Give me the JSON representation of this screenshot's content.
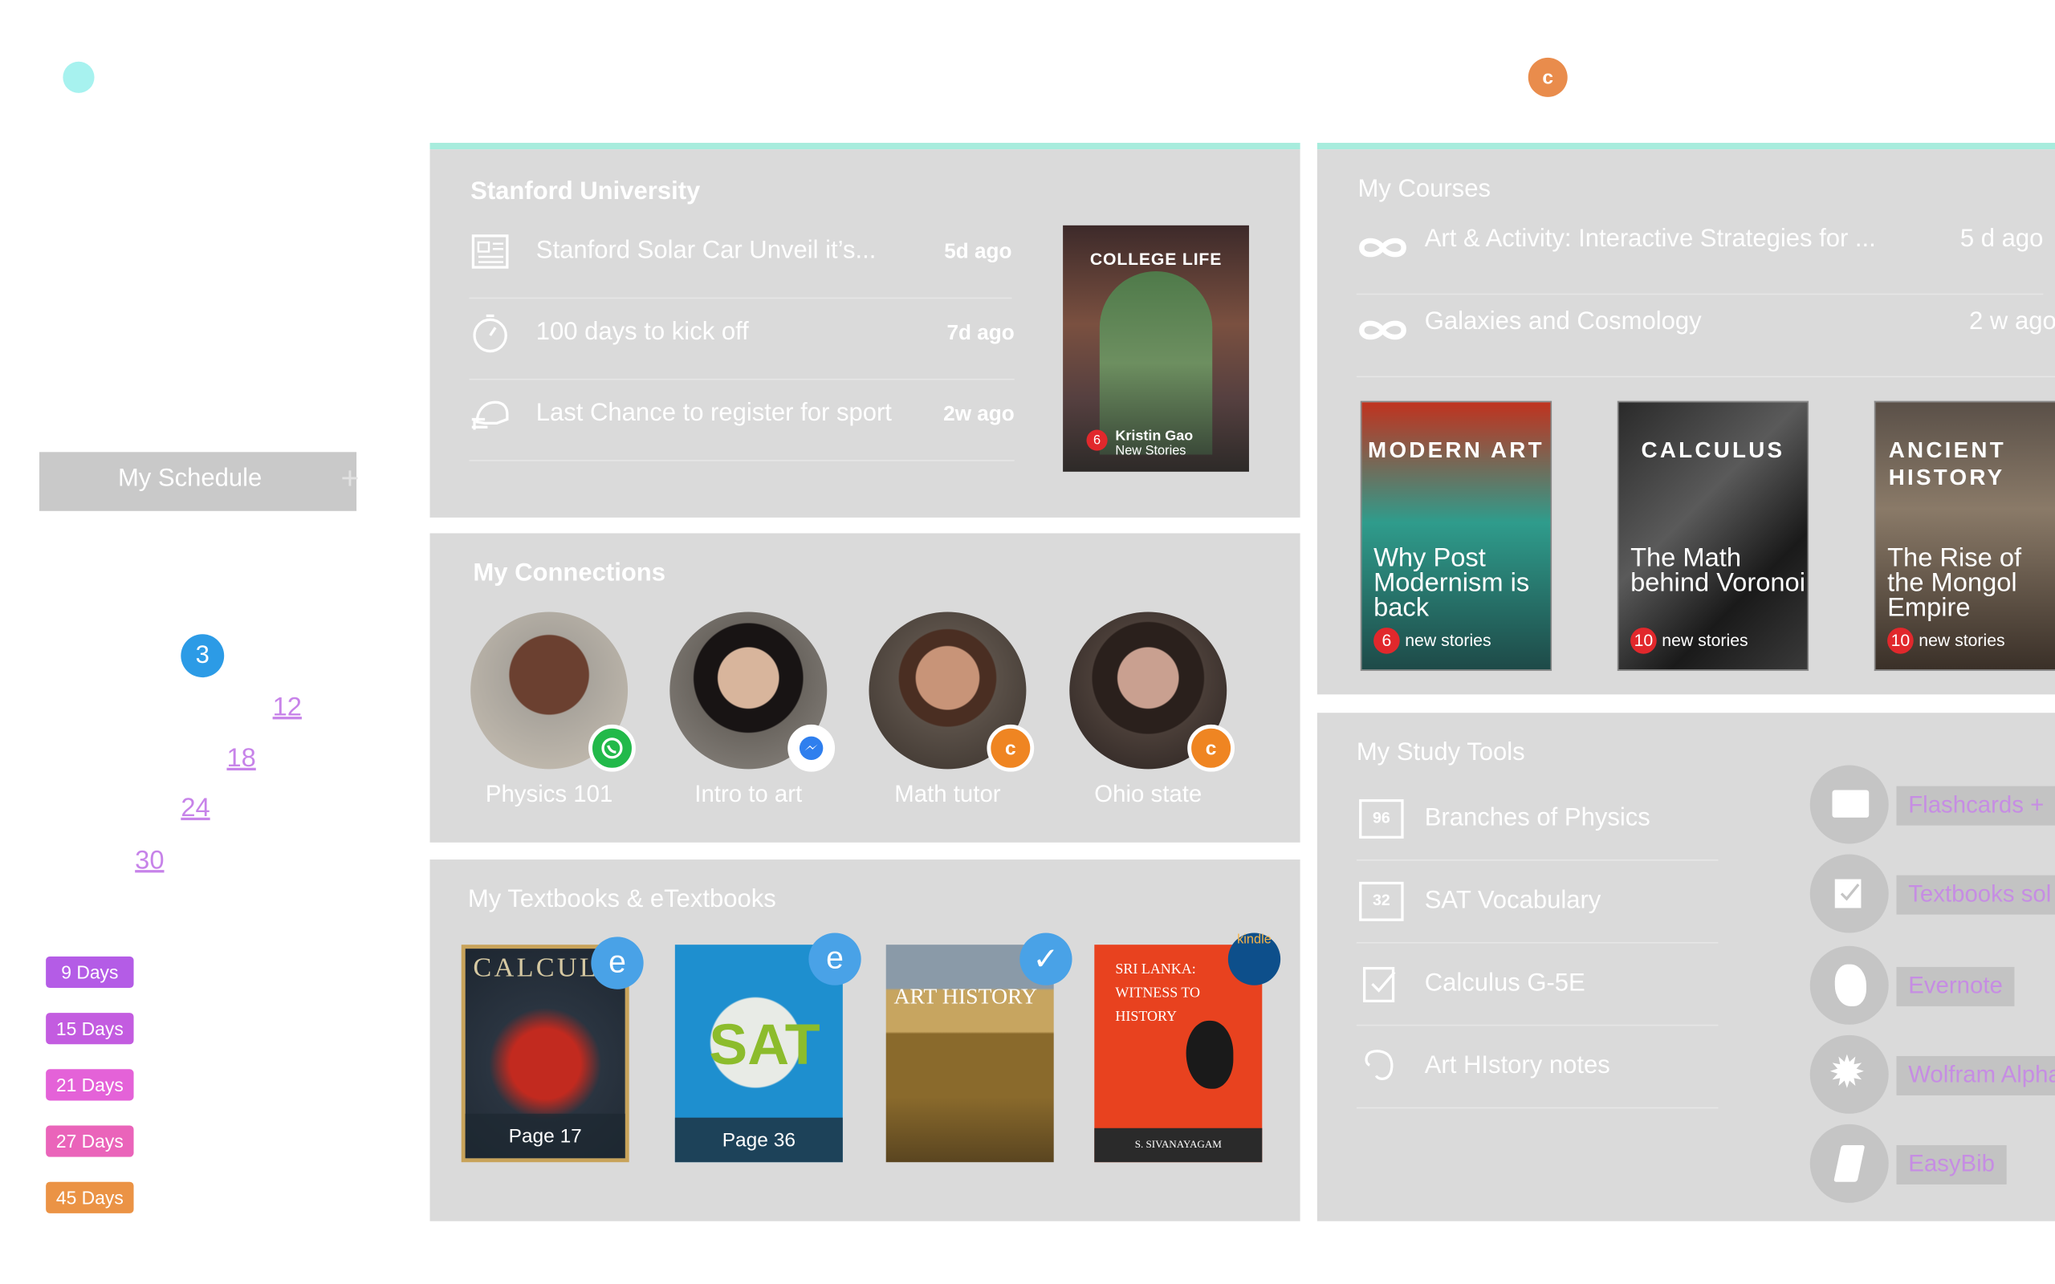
{
  "top": {
    "c_badge": "c"
  },
  "schedule": {
    "label": "My Schedule",
    "plus": "+",
    "badge": "3",
    "dates": [
      "12",
      "18",
      "24",
      "30"
    ],
    "days": [
      "9 Days",
      "15 Days",
      "21 Days",
      "27 Days",
      "45 Days"
    ],
    "day_colors": [
      "#b45ce6",
      "#c35ce0",
      "#e462d8",
      "#ea64ba",
      "#eb9345"
    ]
  },
  "stanford": {
    "title": "Stanford University",
    "items": [
      {
        "text": "Stanford Solar Car Unveil it’s...",
        "age": "5d ago",
        "icon": "newspaper-icon"
      },
      {
        "text": "100 days to kick off",
        "age": "7d ago",
        "icon": "stopwatch-icon"
      },
      {
        "text": "Last Chance to register for sport",
        "age": "2w ago",
        "icon": "football-helmet-icon"
      }
    ],
    "feature": {
      "title": "COLLEGE LIFE",
      "count": "6",
      "name": "Kristin Gao",
      "sub": "New Stories"
    }
  },
  "connections": {
    "title": "My Connections",
    "items": [
      {
        "label": "Physics 101",
        "badge": "whatsapp-icon",
        "color": "#22b94a"
      },
      {
        "label": "Intro to art",
        "badge": "messenger-icon",
        "color": "#2f7fee"
      },
      {
        "label": "Math tutor",
        "badge": "c",
        "color": "#ef8522"
      },
      {
        "label": "Ohio state",
        "badge": "c",
        "color": "#ef8522"
      }
    ]
  },
  "textbooks": {
    "title": "My Textbooks & eTextbooks",
    "books": [
      {
        "cover": "CALCULU",
        "page": "Page 17",
        "badge": "e"
      },
      {
        "cover": "SAT",
        "page": "Page 36",
        "badge": "e"
      },
      {
        "cover": "ART HISTORY",
        "page": "",
        "badge": "✓"
      },
      {
        "cover": "SRI LANKA: WITNESS TO HISTORY",
        "page": "",
        "badge": "kindle",
        "author": "S. SIVANAYAGAM"
      }
    ]
  },
  "courses": {
    "title": "My Courses",
    "items": [
      {
        "text": "Art & Activity: Interactive Strategies for ...",
        "age": "5 d ago"
      },
      {
        "text": "Galaxies and Cosmology",
        "age": "2 w ago"
      }
    ],
    "books": [
      {
        "title": "MODERN ART",
        "sub": "Why Post Modernism is back",
        "count": "6",
        "label": "new stories"
      },
      {
        "title": "CALCULUS",
        "sub": "The Math behind Voronoi",
        "count": "10",
        "label": "new stories"
      },
      {
        "title": "ANCIENT HISTORY",
        "sub": "The Rise of the Mongol Empire",
        "count": "10",
        "label": "new stories"
      }
    ]
  },
  "study": {
    "title": "My Study Tools",
    "items": [
      {
        "text": "Branches of Physics",
        "num": "96"
      },
      {
        "text": "SAT Vocabulary",
        "num": "32"
      },
      {
        "text": "Calculus G-5E",
        "num": ""
      },
      {
        "text": "Art HIstory notes",
        "num": ""
      }
    ],
    "tools": [
      {
        "label": "Flashcards +",
        "icon": "flashcards-icon"
      },
      {
        "label": "Textbooks sol",
        "icon": "textbook-check-icon"
      },
      {
        "label": "Evernote",
        "icon": "evernote-icon"
      },
      {
        "label": "Wolfram Alpha",
        "icon": "wolfram-icon"
      },
      {
        "label": "EasyBib",
        "icon": "easybib-icon"
      }
    ]
  }
}
